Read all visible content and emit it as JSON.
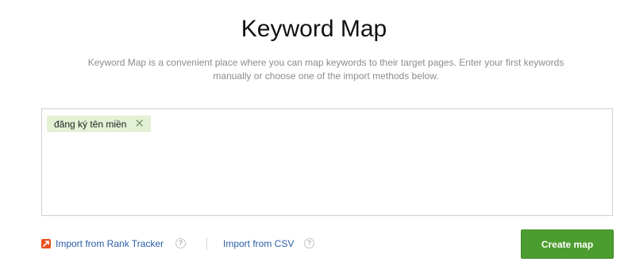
{
  "header": {
    "title": "Keyword Map",
    "description": "Keyword Map is a convenient place where you can map keywords to their target pages. Enter your first keywords manually or choose one of the import methods below."
  },
  "keywords": {
    "tags": [
      {
        "label": "đăng ký tên miền",
        "remove_icon": "close-icon"
      }
    ]
  },
  "footer": {
    "import_rank_tracker": "Import from Rank Tracker",
    "import_csv": "Import from CSV",
    "help_glyph": "?",
    "rank_tracker_icon": "rank-tracker-icon",
    "accent_color": "#e8531d"
  },
  "actions": {
    "create_label": "Create map",
    "create_color": "#4c9d2f"
  }
}
